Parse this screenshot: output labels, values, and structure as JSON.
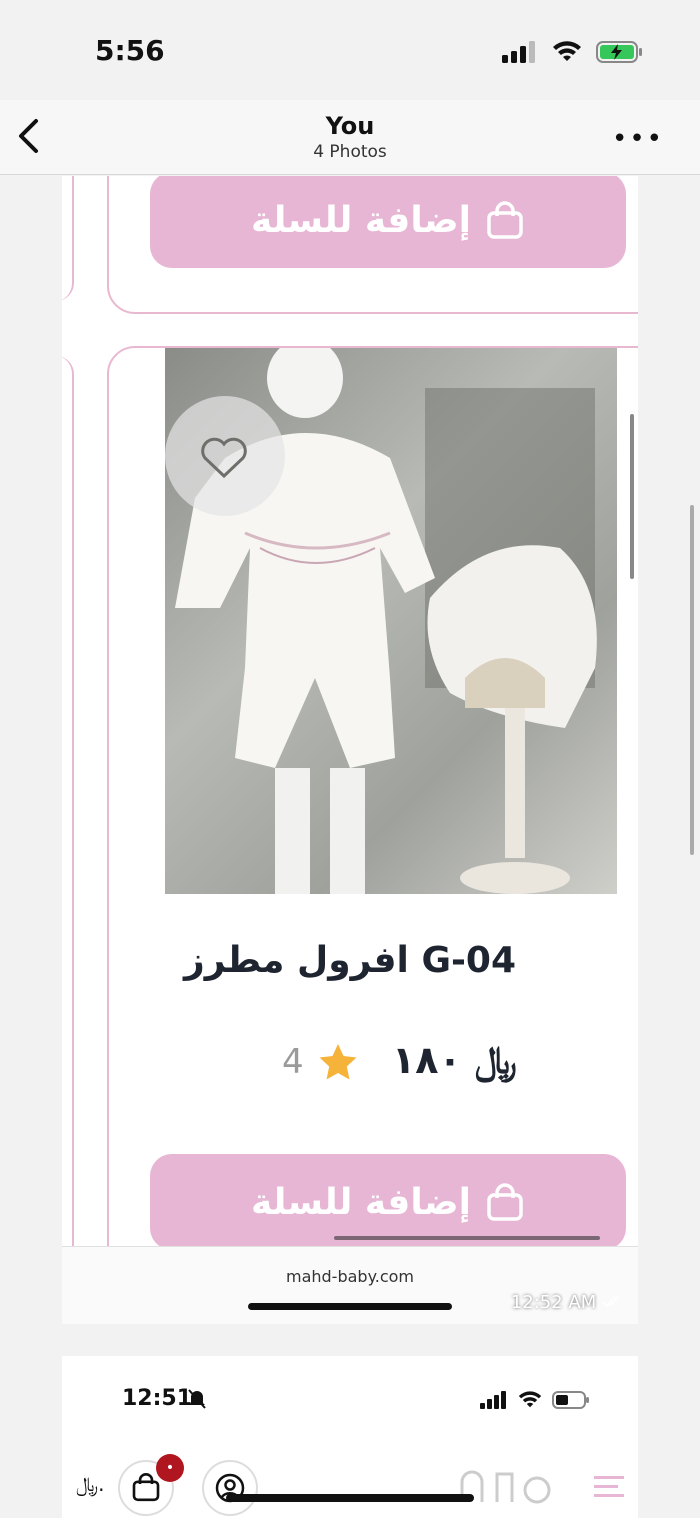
{
  "status_bar": {
    "time": "5:56"
  },
  "nav": {
    "title": "You",
    "subtitle": "4 Photos"
  },
  "product": {
    "add_to_cart_label": "إضافة للسلة",
    "name": "افرول مطرز G-04",
    "price": "١٨٠",
    "currency": "﷼",
    "rating": "4"
  },
  "browser": {
    "url": "mahd-baby.com"
  },
  "message": {
    "timestamp": "12:52 AM"
  },
  "second_photo": {
    "time": "12:51",
    "cart_badge": "•",
    "currency": "﷼."
  },
  "colors": {
    "accent_pink": "#e7b6d4",
    "border_pink": "#e8b8d0",
    "star": "#f6b33a",
    "text_dark": "#1e2530"
  }
}
